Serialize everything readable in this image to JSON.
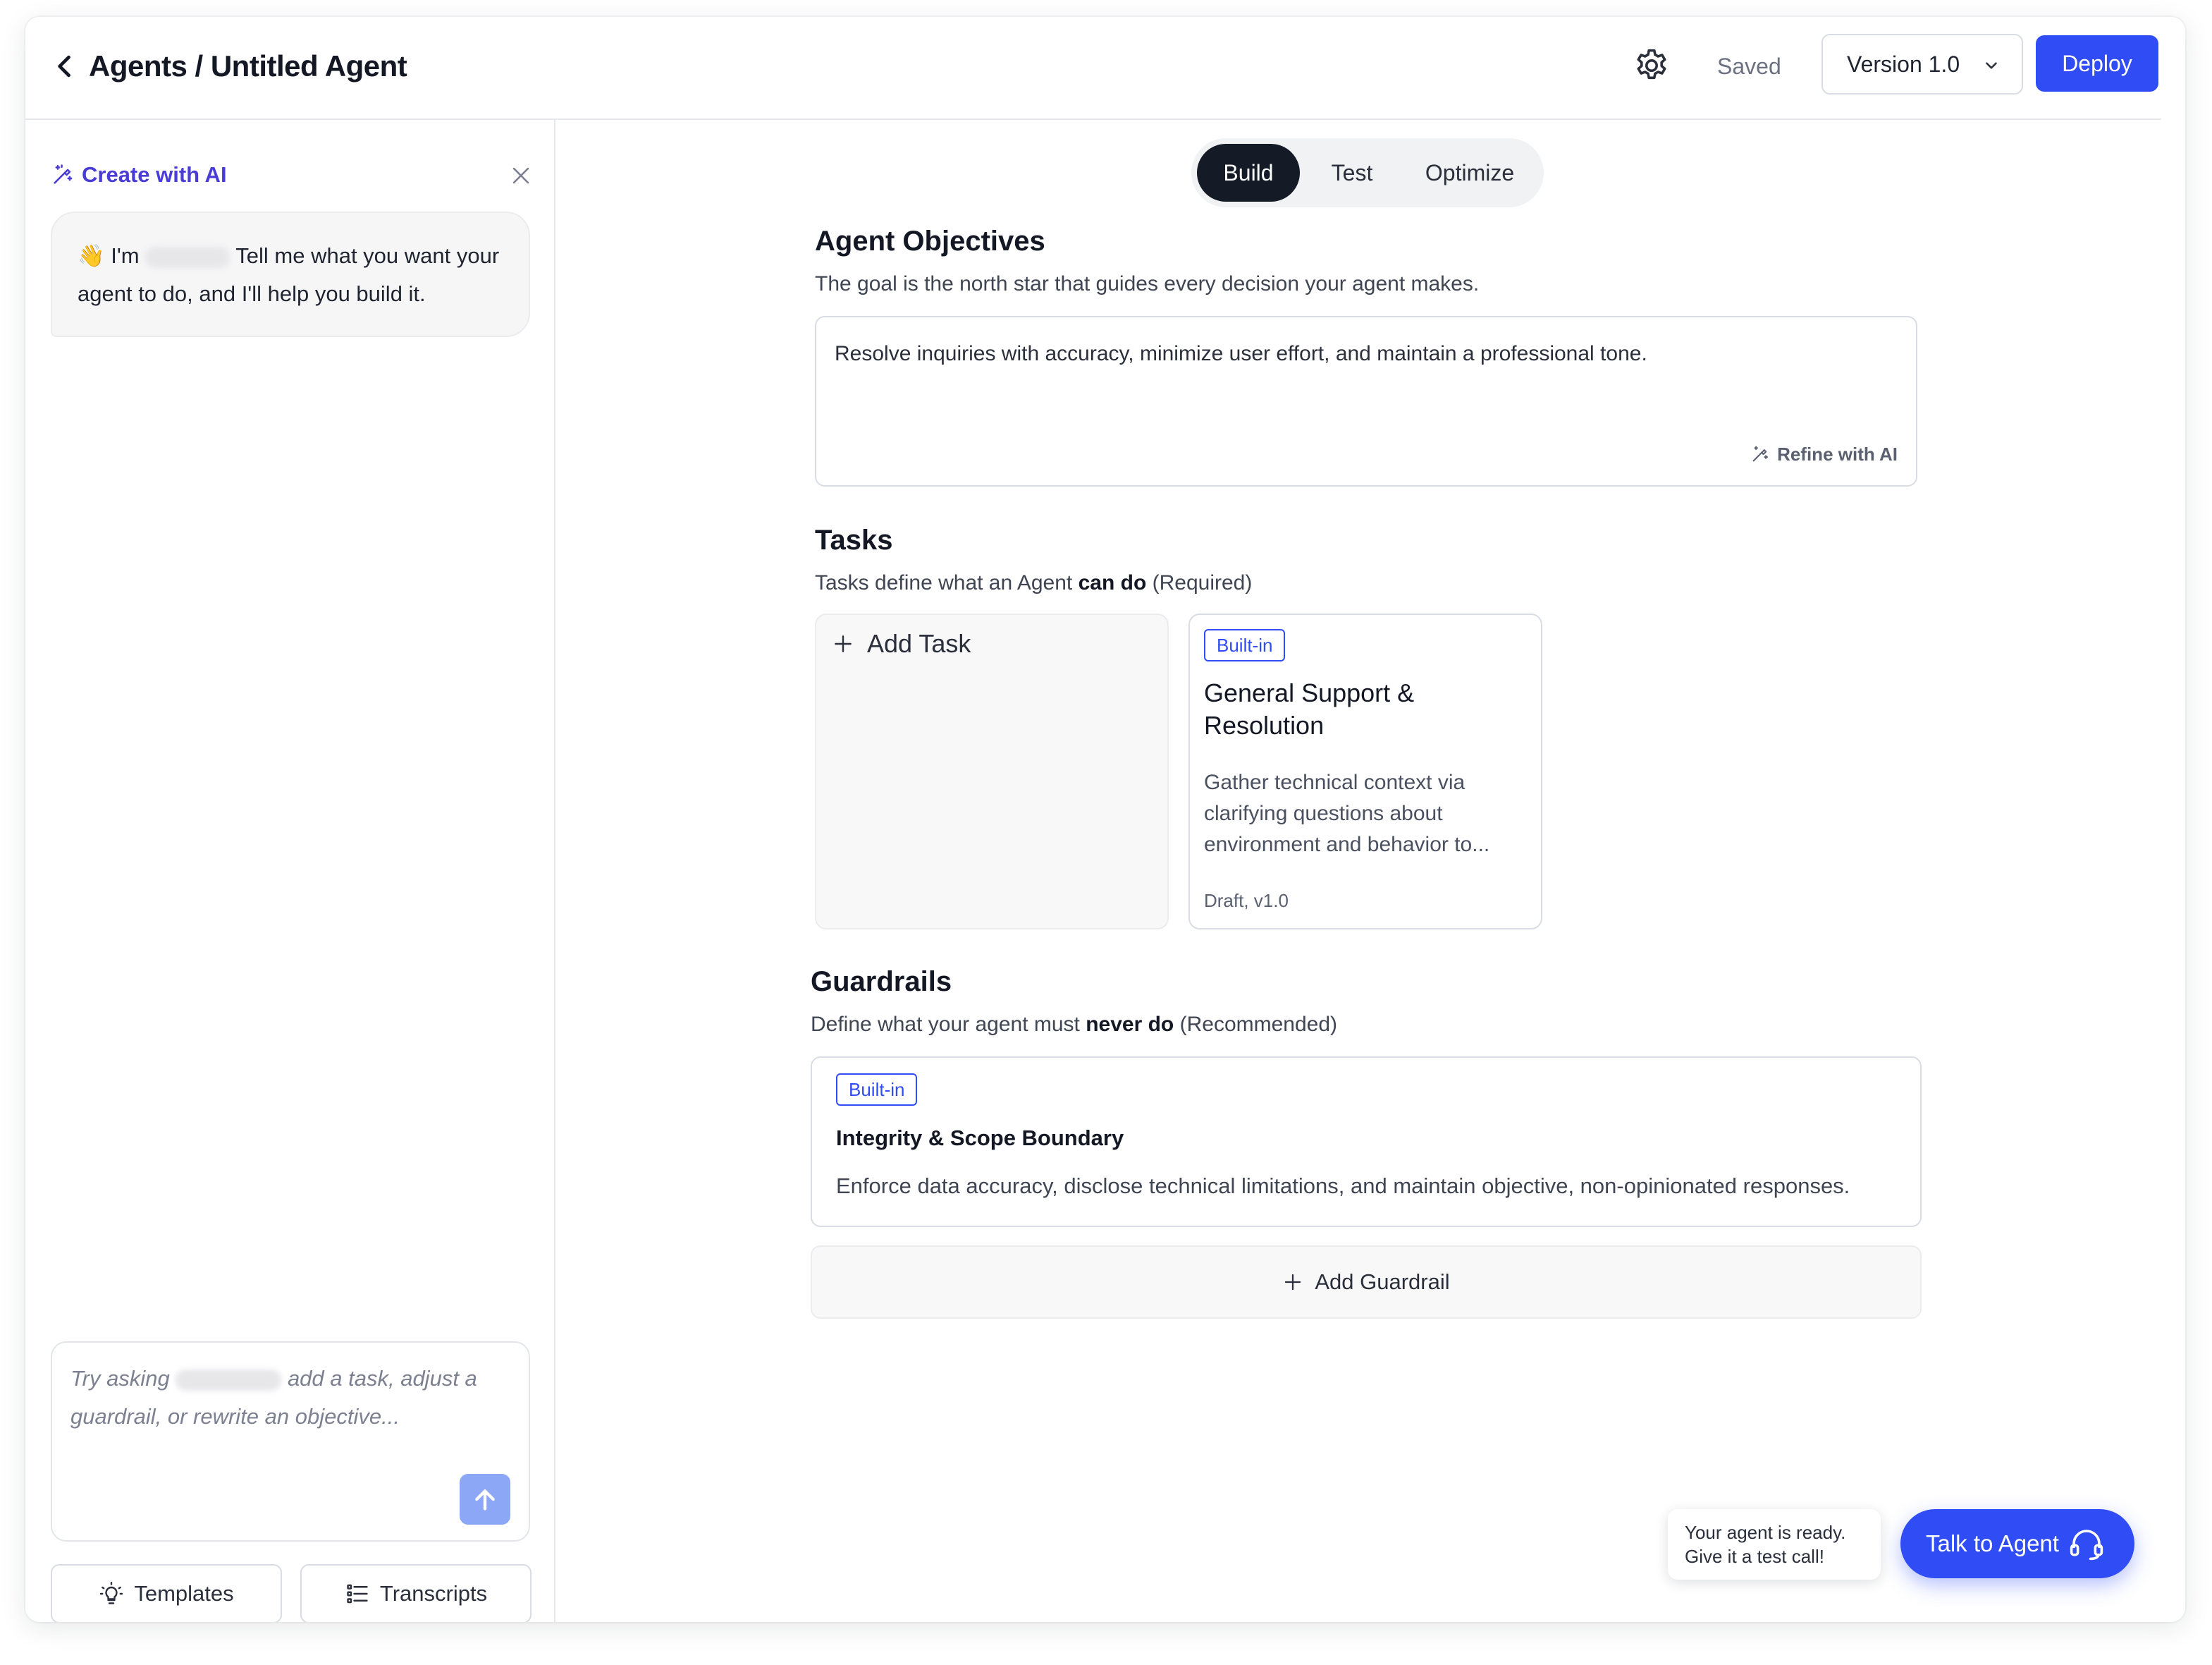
{
  "header": {
    "breadcrumb": "Agents / Untitled Agent",
    "status": "Saved",
    "version": "Version 1.0",
    "deploy_label": "Deploy"
  },
  "sidebar": {
    "title": "Create with AI",
    "greeting_emoji": "👋",
    "greeting_prefix": "I'm",
    "greeting_rest": "Tell me what you want your agent to do, and I'll help you build it.",
    "input_placeholder_a": "Try asking",
    "input_placeholder_b": "add a task, adjust a guardrail, or rewrite an objective...",
    "templates_label": "Templates",
    "transcripts_label": "Transcripts"
  },
  "tabs": [
    "Build",
    "Test",
    "Optimize"
  ],
  "objectives": {
    "heading": "Agent Objectives",
    "subtitle": "The goal is the north star that guides every decision your agent makes.",
    "value": "Resolve inquiries with accuracy, minimize user effort, and maintain a professional tone.",
    "refine_label": "Refine with AI"
  },
  "tasks": {
    "heading": "Tasks",
    "subtitle_a": "Tasks define what an Agent ",
    "subtitle_bold": "can do",
    "subtitle_b": " (Required)",
    "add_label": "Add Task",
    "card": {
      "badge": "Built-in",
      "title": "General Support & Resolution",
      "description": "Gather technical context via clarifying questions about environment and behavior to...",
      "meta": "Draft, v1.0"
    }
  },
  "guardrails": {
    "heading": "Guardrails",
    "subtitle_a": "Define what your agent must ",
    "subtitle_bold": "never do",
    "subtitle_b": " (Recommended)",
    "card": {
      "badge": "Built-in",
      "title": "Integrity & Scope Boundary",
      "description": "Enforce data accuracy, disclose technical limitations, and maintain objective, non-opinionated responses."
    },
    "add_label": "Add Guardrail"
  },
  "callout": {
    "line1": "Your agent is ready.",
    "line2": "Give it a test call!",
    "button_label": "Talk to Agent"
  },
  "colors": {
    "accent": "#2f4cf5",
    "ai_purple": "#4a3dd6",
    "tab_active": "#141a26"
  }
}
